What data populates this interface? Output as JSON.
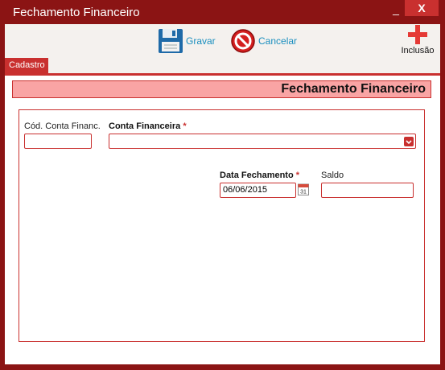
{
  "window": {
    "title": "Fechamento Financeiro",
    "minimize_label": "_",
    "close_label": "X"
  },
  "toolbar": {
    "gravar_label": "Gravar",
    "cancelar_label": "Cancelar",
    "inclusao_label": "Inclusão"
  },
  "tabs": [
    {
      "label": "Cadastro",
      "active": true
    }
  ],
  "form": {
    "header_title": "Fechamento Financeiro",
    "cod_conta_label": "Cód. Conta Financ.",
    "cod_conta_value": "",
    "conta_financeira_label": "Conta Financeira",
    "conta_financeira_value": "",
    "required_mark": "*",
    "data_fechamento_label": "Data Fechamento",
    "data_fechamento_value": "06/06/2015",
    "calendar_day": "31",
    "saldo_label": "Saldo",
    "saldo_value": ""
  },
  "colors": {
    "brand": "#8b1414",
    "accent": "#c9302f",
    "header_fill": "#f9a4a4",
    "link": "#1a8fbf"
  }
}
